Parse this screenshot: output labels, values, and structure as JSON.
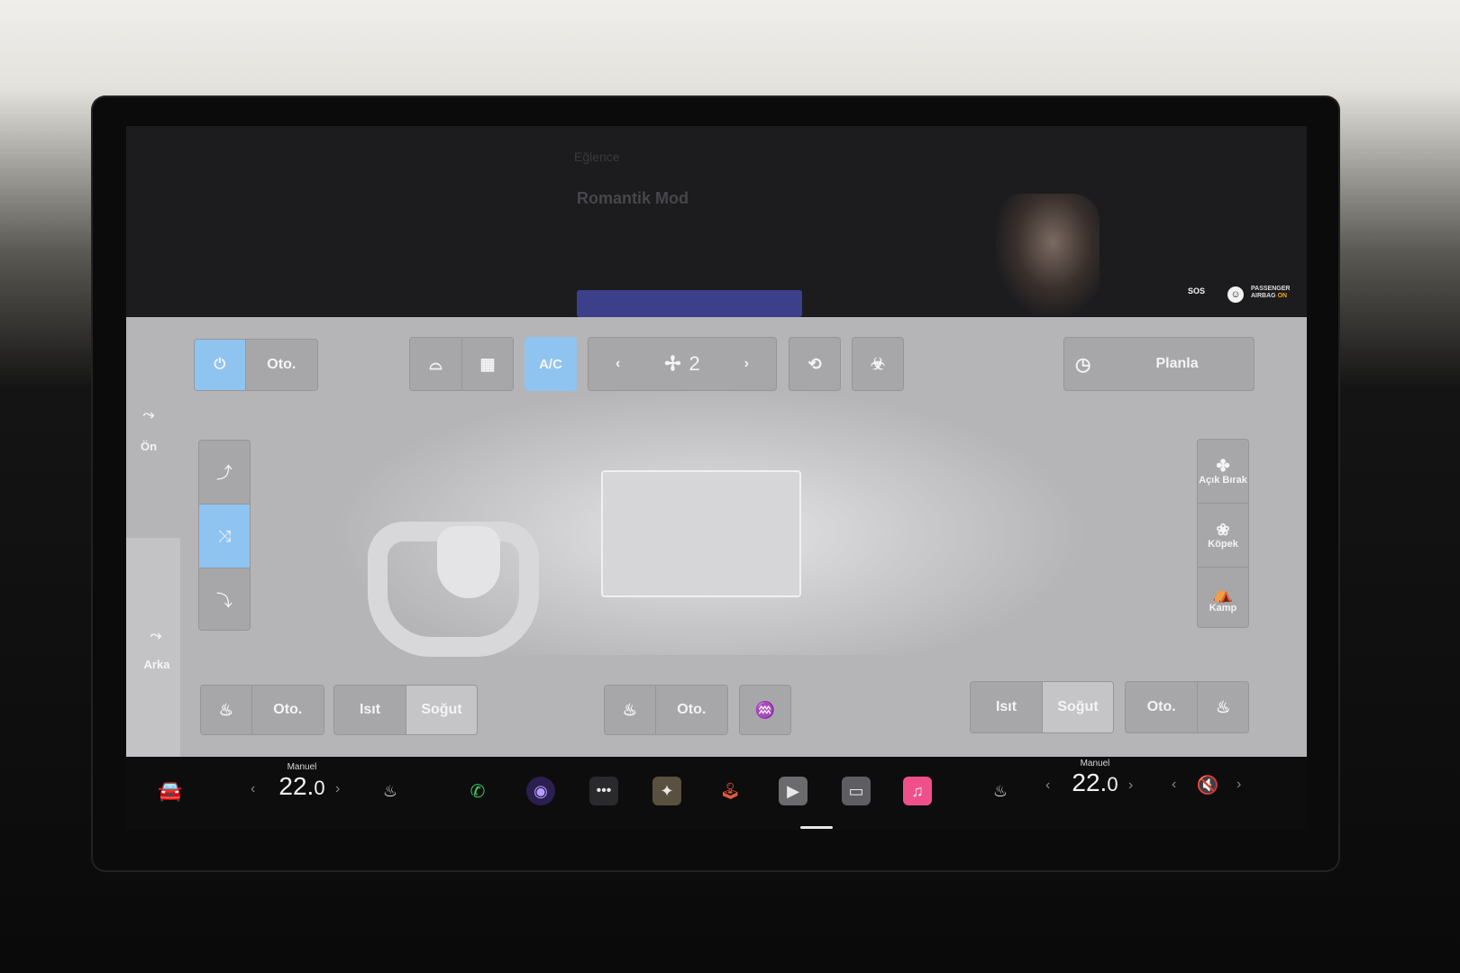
{
  "background_media": {
    "section_label": "Eğlence",
    "title": "Romantik Mod"
  },
  "status": {
    "sos_label": "SOS",
    "airbag_line1": "PASSENGER",
    "airbag_line2a": "AIRBAG",
    "airbag_line2b": "ON"
  },
  "climate": {
    "power_icon": "power-icon",
    "auto_label": "Oto.",
    "defrost_front_icon": "defrost-front-icon",
    "defrost_rear_icon": "defrost-rear-icon",
    "ac_label": "A/C",
    "fan_speed": "2",
    "recirculate_icon": "recirculate-icon",
    "bioweapon_icon": "bioweapon-icon",
    "schedule_label": "Planla",
    "front_label": "Ön",
    "rear_label": "Arka",
    "vents": [
      "face-vent",
      "face-feet-vent",
      "feet-vent"
    ],
    "active_vent_index": 1,
    "right_modes": [
      {
        "label": "Açık Bırak",
        "icon": "fan-icon"
      },
      {
        "label": "Köpek",
        "icon": "paw-icon"
      },
      {
        "label": "Kamp",
        "icon": "tent-icon"
      }
    ],
    "driver_seat": {
      "auto_label": "Oto.",
      "heat_label": "Isıt",
      "cool_label": "Soğut"
    },
    "center": {
      "auto_label": "Oto."
    },
    "passenger_seat": {
      "heat_label": "Isıt",
      "cool_label": "Soğut",
      "auto_label": "Oto."
    }
  },
  "taskbar": {
    "driver_temp": {
      "mode": "Manuel",
      "value": "22.",
      "decimal": "0"
    },
    "passenger_temp": {
      "mode": "Manuel",
      "value": "22.",
      "decimal": "0"
    },
    "music_app_color": "#f0508a",
    "camera_app_color": "#7a5cff",
    "phone_color": "#3ccf5e"
  }
}
